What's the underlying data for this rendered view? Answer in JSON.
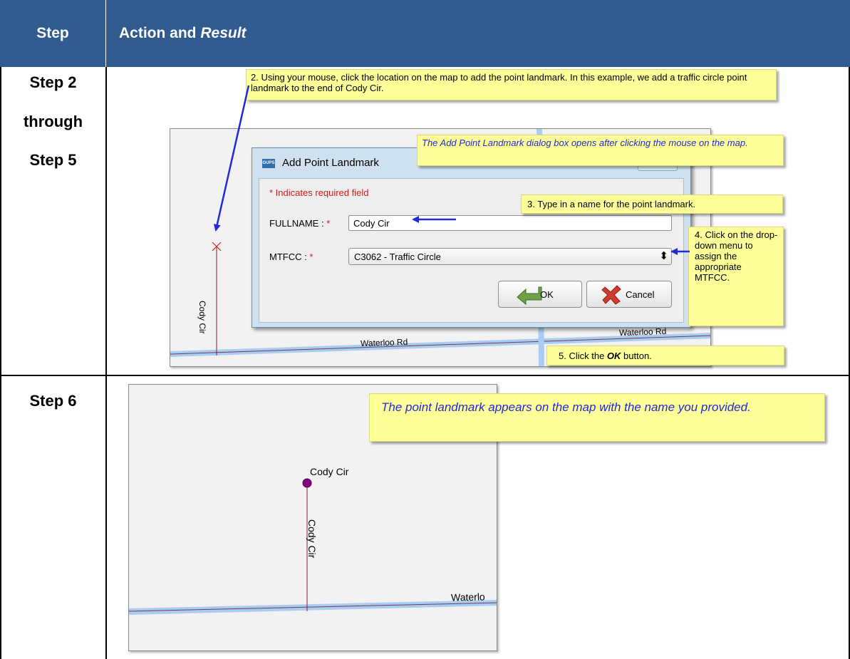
{
  "header": {
    "step": "Step",
    "action": "Action and ",
    "result": "Result"
  },
  "rows": [
    {
      "step_lines": [
        "Step 2",
        "through",
        "Step 5"
      ]
    },
    {
      "step_lines": [
        "Step 6"
      ]
    }
  ],
  "callouts": {
    "c2": "2. Using your mouse, click the location on the map to add the point landmark. In this example, we add a traffic circle point landmark to the end of Cody Cir.",
    "c_dialog": "The Add Point Landmark dialog box opens after clicking the mouse on the map.",
    "c3": "3. Type in a name for the point landmark.",
    "c4": "4. Click on the drop-down menu to assign the appropriate MTFCC.",
    "c5_prefix": "5. Click the ",
    "c5_ok": "OK",
    "c5_suffix": " button.",
    "c6": "The point landmark appears on the map with the name you provided."
  },
  "dialog": {
    "app_icon": "GUPS",
    "title": "Add Point Landmark",
    "required_note": "* Indicates required field",
    "fullname_label": "FULLNAME : ",
    "fullname_value": "Cody Cir",
    "mtfcc_label": "MTFCC : ",
    "required_star": "*",
    "mtfcc_value": "C3062 - Traffic Circle",
    "ok_label": "OK",
    "cancel_label": "Cancel"
  },
  "map1": {
    "street_vertical": "Cody Cir",
    "street_h_left": "Waterloo Rd",
    "street_h_right": "Waterloo Rd"
  },
  "map2": {
    "point_label": "Cody Cir",
    "street_vertical": "Cody Cir",
    "street_h": "Waterlo"
  },
  "colors": {
    "header_bg": "#2f5b8f",
    "callout_bg": "#ffff99",
    "arrow": "#1f2bd6",
    "road": "#a9cdf2",
    "point": "#800080"
  }
}
